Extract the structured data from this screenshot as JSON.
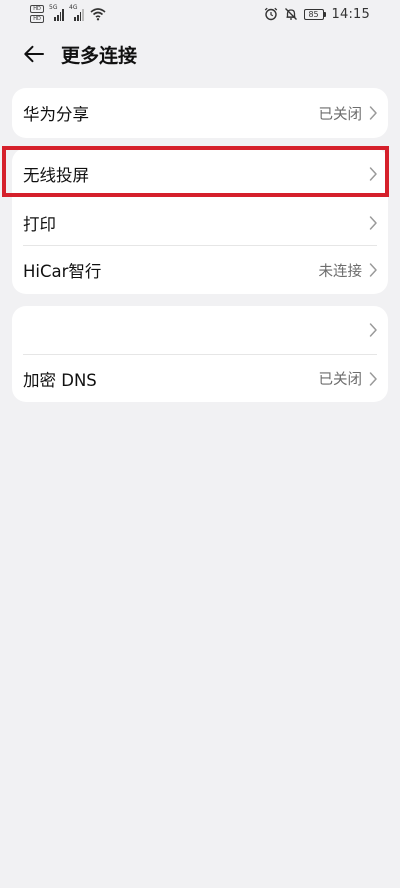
{
  "status_bar": {
    "hd_top": "HD",
    "hd_bottom": "HD",
    "sim1_gen": "5G",
    "sim2_gen": "4G",
    "battery": "85",
    "time": "14:15",
    "icons": [
      "hd-icon",
      "signal-icon",
      "wifi-icon",
      "alarm-icon",
      "mute-icon",
      "battery-icon"
    ]
  },
  "header": {
    "title": "更多连接",
    "back_icon": "back-arrow-icon"
  },
  "card1": {
    "rows": [
      {
        "label": "华为分享",
        "value": "已关闭"
      }
    ]
  },
  "card2": {
    "rows": [
      {
        "label": "无线投屏",
        "value": ""
      },
      {
        "label": "打印",
        "value": ""
      },
      {
        "label": "HiCar智行",
        "value": "未连接"
      }
    ]
  },
  "card3": {
    "rows": [
      {
        "label": "",
        "value": ""
      },
      {
        "label": "加密 DNS",
        "value": "已关闭"
      }
    ]
  },
  "colors": {
    "background": "#f1f1f3",
    "card": "#ffffff",
    "highlight": "#d5202b",
    "secondary_text": "#6d6d6d"
  }
}
